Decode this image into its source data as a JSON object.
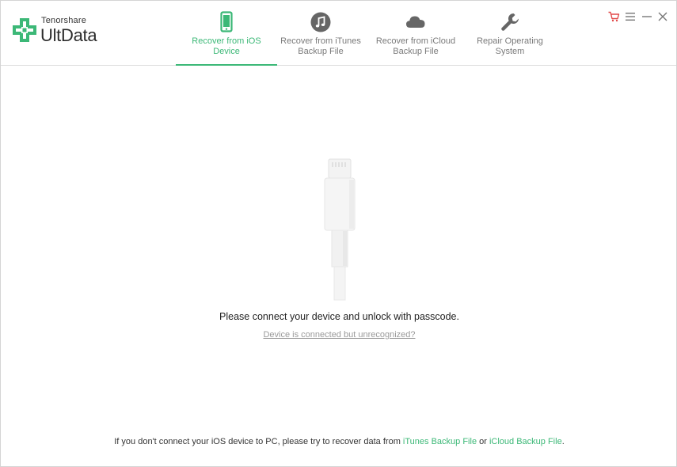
{
  "app": {
    "brand_small": "Tenorshare",
    "brand_name": "UltData",
    "accent_color": "#3cb877"
  },
  "tabs": [
    {
      "label": "Recover from iOS\nDevice",
      "icon": "phone-icon",
      "active": true
    },
    {
      "label": "Recover from iTunes\nBackup File",
      "icon": "itunes-music-icon",
      "active": false
    },
    {
      "label": "Recover from iCloud\nBackup File",
      "icon": "cloud-icon",
      "active": false
    },
    {
      "label": "Repair Operating\nSystem",
      "icon": "wrench-icon",
      "active": false
    }
  ],
  "window_controls": {
    "icons": [
      "cart-icon",
      "menu-icon",
      "minimize-icon",
      "close-icon"
    ]
  },
  "main": {
    "illustration": "lightning-cable-icon",
    "connect_message": "Please connect your device and unlock with passcode.",
    "unrecognized_link": "Device is connected but unrecognized?"
  },
  "footer": {
    "prefix": "If you don't connect your iOS device to PC, please try to recover data from ",
    "itunes_link": "iTunes Backup File",
    "middle": " or ",
    "icloud_link": "iCloud Backup File",
    "suffix": "."
  }
}
